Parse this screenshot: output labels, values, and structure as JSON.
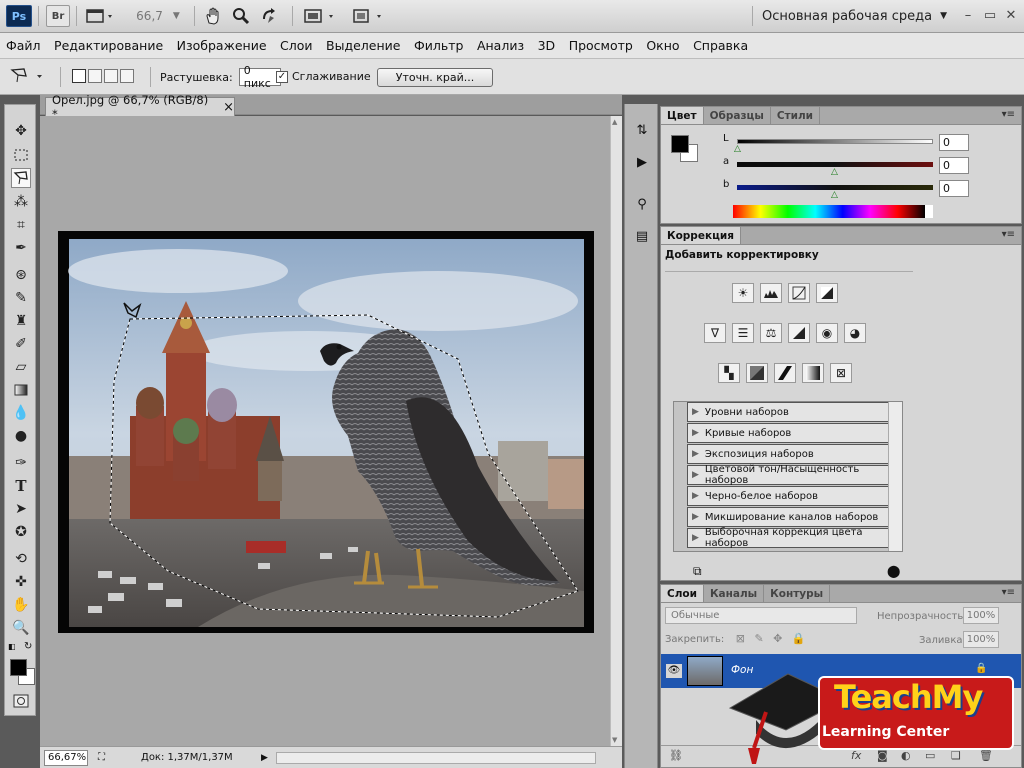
{
  "appbar": {
    "ps_label": "Ps",
    "br_label": "Br",
    "zoom_value": "66,7",
    "workspace": "Основная рабочая среда",
    "icons": [
      "layout-icon",
      "hand-icon",
      "zoom-icon",
      "rotate-view-icon",
      "arrange-docs-icon",
      "screen-mode-icon"
    ]
  },
  "menu": [
    "Файл",
    "Редактирование",
    "Изображение",
    "Слои",
    "Выделение",
    "Фильтр",
    "Анализ",
    "3D",
    "Просмотр",
    "Окно",
    "Справка"
  ],
  "options": {
    "feather_label": "Растушевка:",
    "feather_value": "0 пикс",
    "antialias_label": "Сглаживание",
    "antialias_checked": "✓",
    "refine_edge": "Уточн. край..."
  },
  "document": {
    "tab_title": "Орел.jpg @ 66,7% (RGB/8) *",
    "close": "×",
    "zoom_status": "66,67%",
    "doc_info": "Док: 1,37M/1,37M"
  },
  "color_panel": {
    "tabs": [
      "Цвет",
      "Образцы",
      "Стили"
    ],
    "channels": [
      {
        "label": "L",
        "value": "0"
      },
      {
        "label": "a",
        "value": "0"
      },
      {
        "label": "b",
        "value": "0"
      }
    ]
  },
  "adjust_panel": {
    "tab": "Коррекция",
    "heading": "Добавить корректировку",
    "presets": [
      "Уровни наборов",
      "Кривые наборов",
      "Экспозиция наборов",
      "Цветовой тон/Насыщенность наборов",
      "Черно-белое наборов",
      "Микширование каналов наборов",
      "Выборочная коррекция цвета наборов"
    ]
  },
  "layers_panel": {
    "tabs": [
      "Слои",
      "Каналы",
      "Контуры"
    ],
    "blend_mode": "Обычные",
    "opacity_label": "Непрозрачность:",
    "opacity_value": "100%",
    "lock_label": "Закрепить:",
    "fill_label": "Заливка:",
    "fill_value": "100%",
    "layer_name": "Фон"
  },
  "watermark": {
    "line1": "TeachMy",
    "line2": "Learning Center"
  },
  "colors": {
    "accent_selection": "#1f56b0",
    "foreground": "#000000",
    "background": "#ffffff"
  }
}
